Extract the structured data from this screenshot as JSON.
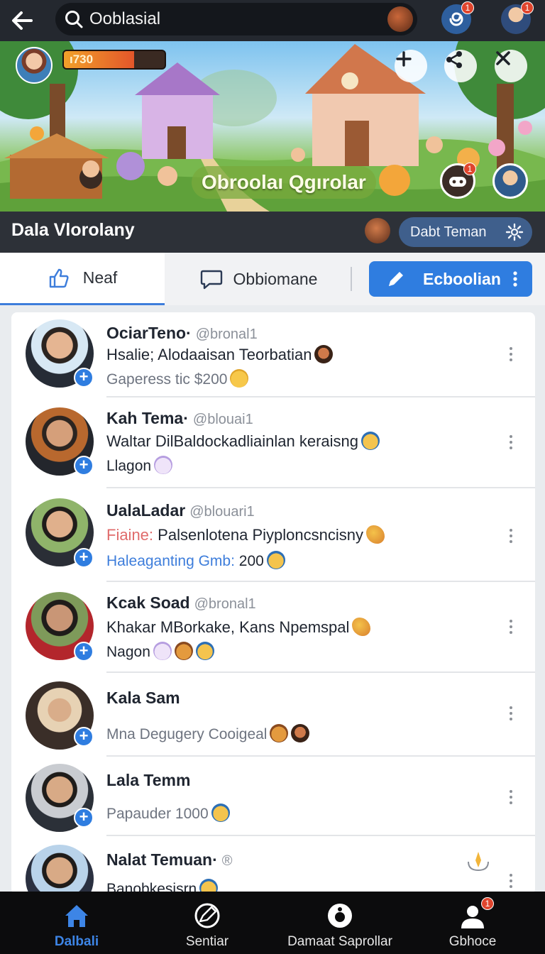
{
  "topbar": {
    "search_text": "Ooblasial",
    "bell_badge": "1",
    "avatar_badge": "1"
  },
  "hero": {
    "xp_text": "ı730",
    "xp_fraction": 0.7,
    "title": "Obroolaı Qgırolar",
    "round_badge": "1"
  },
  "group": {
    "title": "Dala Vlorolany",
    "friend_button": "Dabt Teman"
  },
  "tabs": [
    {
      "label": "Neaf",
      "active": true
    },
    {
      "label": "Obbiomane",
      "active": false
    },
    {
      "label": "Ecboolian",
      "active": false
    }
  ],
  "posts": [
    {
      "name": "OciarTeno·",
      "handle": "@bronal1",
      "line1": "Hsalie; Alodaaisan Teorbatian",
      "line1_prefix": "",
      "line2": "Gaperess tic $200",
      "line2_prefix": ""
    },
    {
      "name": "Kah Tema·",
      "handle": "@blouai1",
      "line1": "Waltar DilBaldockadliainlan keraisng",
      "line1_prefix": "",
      "line2": "Llagon",
      "line2_prefix": ""
    },
    {
      "name": "UalaLadar",
      "handle": "@blouari1",
      "line1": "Palsenlotena Piyploncsncisny",
      "line1_prefix": "Fiaine:",
      "line2": "200",
      "line2_prefix": "Haleaganting Gmb:"
    },
    {
      "name": "Kcak Soad",
      "handle": "@bronal1",
      "line1": "Khakar MBorkake, Kans Npemspal",
      "line1_prefix": "",
      "line2": "Nagon",
      "line2_prefix": ""
    },
    {
      "name": "Kala Sam",
      "handle": "",
      "line1": "",
      "line1_prefix": "",
      "line2": "Mna Deguɡery Cooigeal",
      "line2_prefix": ""
    },
    {
      "name": "Lala Temm",
      "handle": "",
      "line1": "",
      "line1_prefix": "",
      "line2": "Papauder 1000",
      "line2_prefix": ""
    },
    {
      "name": "Nalat Temuan·",
      "handle": "®",
      "line1": "",
      "line1_prefix": "",
      "line2": "Banobkesisrn",
      "line2_prefix": ""
    }
  ],
  "bottom_nav": [
    {
      "label": "Dalbali",
      "active": true
    },
    {
      "label": "Sentiar",
      "active": false
    },
    {
      "label": "Damaat Saprollar",
      "active": false
    },
    {
      "label": "Gbhoce",
      "active": false,
      "badge": "1"
    }
  ],
  "colors": {
    "accent": "#2f7de0",
    "topbar": "#24282f",
    "badge": "#e0452d"
  }
}
